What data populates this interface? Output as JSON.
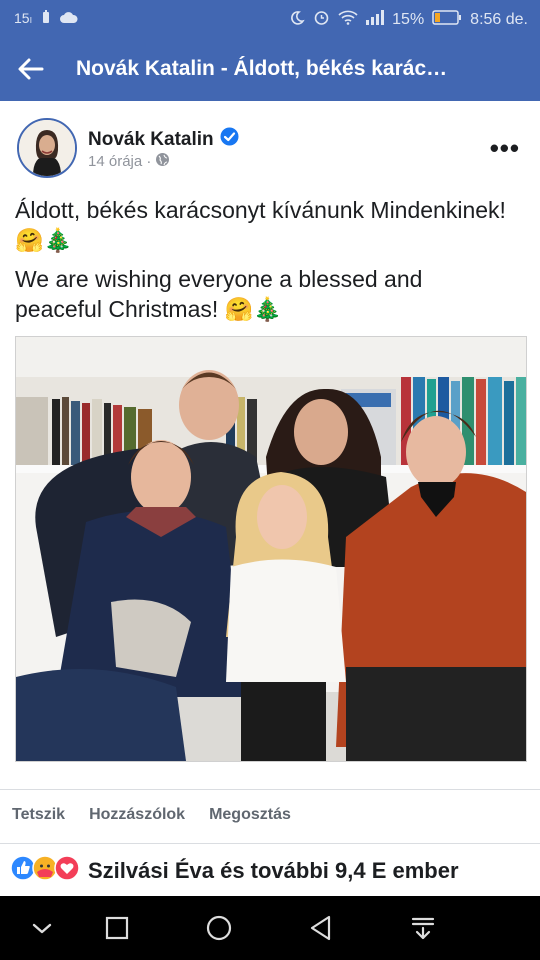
{
  "status_bar": {
    "left_badge": "15ₗ",
    "battery_percent": "15%",
    "time": "8:56 de."
  },
  "app_bar": {
    "title": "Novák Katalin - Áldott, békés karác…"
  },
  "post": {
    "author": "Novák Katalin",
    "time": "14 órája ·",
    "text_hu": "Áldott, békés karácsonyt kívánunk Mindenkinek! 🤗🎄",
    "text_en": "We are wishing everyone a blessed and peaceful Christmas! 🤗🎄",
    "more_label": "•••"
  },
  "actions": {
    "like": "Tetszik",
    "comment": "Hozzászólok",
    "share": "Megosztás"
  },
  "reactions": {
    "summary": "Szilvási Éva és további 9,4 E ember"
  },
  "colors": {
    "brand": "#4267b2",
    "verified": "#1877f2",
    "like_blue": "#2d88ff",
    "love_red": "#f33e58",
    "care_yellow": "#f7b125"
  },
  "icons": [
    "back-arrow-icon",
    "verified-icon",
    "globe-icon",
    "more-icon",
    "like-reaction-icon",
    "care-reaction-icon",
    "love-reaction-icon",
    "nav-down-icon",
    "recents-icon",
    "home-icon",
    "back-nav-icon",
    "notifications-icon"
  ]
}
